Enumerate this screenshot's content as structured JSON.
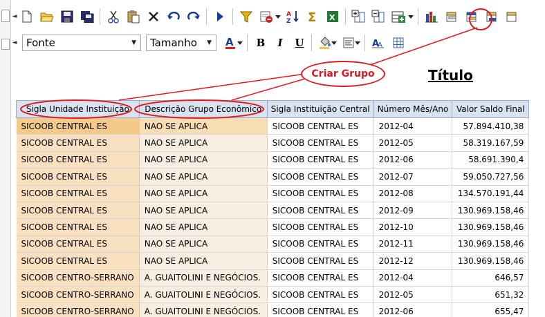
{
  "toolbar_row1": {
    "icons": [
      "new-document-icon",
      "open-folder-icon",
      "save-icon",
      "save-all-icon",
      "cut-icon",
      "paste-icon",
      "delete-icon",
      "undo-icon",
      "redo-icon",
      "run-icon",
      "filter-icon",
      "clear-filter-icon",
      "sort-az-icon",
      "sum-icon",
      "export-excel-icon",
      "add-column-icon",
      "edit-column-icon",
      "add-row-icon",
      "chart-icon",
      "create-group-icon",
      "group-header-icon",
      "group-footer-icon",
      "group-more-icon"
    ]
  },
  "toolbar_row2": {
    "font_select": "Fonte",
    "size_select": "Tamanho",
    "bold": "B",
    "italic": "I",
    "underline": "U"
  },
  "title": "Título",
  "callout": {
    "label": "Criar Grupo",
    "color": "#e01820"
  },
  "table": {
    "columns": [
      "Sigla Unidade Instituição",
      "Descrição Grupo Econômico",
      "Sigla Instituição Central",
      "Número Mês/Ano",
      "Valor Saldo Final"
    ],
    "rows": [
      [
        "SICOOB CENTRAL ES",
        "NAO SE APLICA",
        "SICOOB CENTRAL ES",
        "2012-04",
        "57.894.410,38"
      ],
      [
        "SICOOB CENTRAL ES",
        "NAO SE APLICA",
        "SICOOB CENTRAL ES",
        "2012-05",
        "58.319.167,59"
      ],
      [
        "SICOOB CENTRAL ES",
        "NAO SE APLICA",
        "SICOOB CENTRAL ES",
        "2012-06",
        "58.691.390,4"
      ],
      [
        "SICOOB CENTRAL ES",
        "NAO SE APLICA",
        "SICOOB CENTRAL ES",
        "2012-07",
        "59.050.727,56"
      ],
      [
        "SICOOB CENTRAL ES",
        "NAO SE APLICA",
        "SICOOB CENTRAL ES",
        "2012-08",
        "134.570.191,44"
      ],
      [
        "SICOOB CENTRAL ES",
        "NAO SE APLICA",
        "SICOOB CENTRAL ES",
        "2012-09",
        "130.969.158,46"
      ],
      [
        "SICOOB CENTRAL ES",
        "NAO SE APLICA",
        "SICOOB CENTRAL ES",
        "2012-10",
        "130.969.158,46"
      ],
      [
        "SICOOB CENTRAL ES",
        "NAO SE APLICA",
        "SICOOB CENTRAL ES",
        "2012-11",
        "130.969.158,46"
      ],
      [
        "SICOOB CENTRAL ES",
        "NAO SE APLICA",
        "SICOOB CENTRAL ES",
        "2012-12",
        "130.969.158,46"
      ],
      [
        "SICOOB CENTRO-SERRANO",
        "A. GUAITOLINI E NEGÓCIOS.",
        "SICOOB CENTRAL ES",
        "2012-04",
        "646,57"
      ],
      [
        "SICOOB CENTRO-SERRANO",
        "A. GUAITOLINI E NEGÓCIOS.",
        "SICOOB CENTRAL ES",
        "2012-05",
        "651,32"
      ],
      [
        "SICOOB CENTRO-SERRANO",
        "A. GUAITOLINI E NEGÓCIOS.",
        "SICOOB CENTRAL ES",
        "2012-06",
        "655,47"
      ]
    ]
  }
}
